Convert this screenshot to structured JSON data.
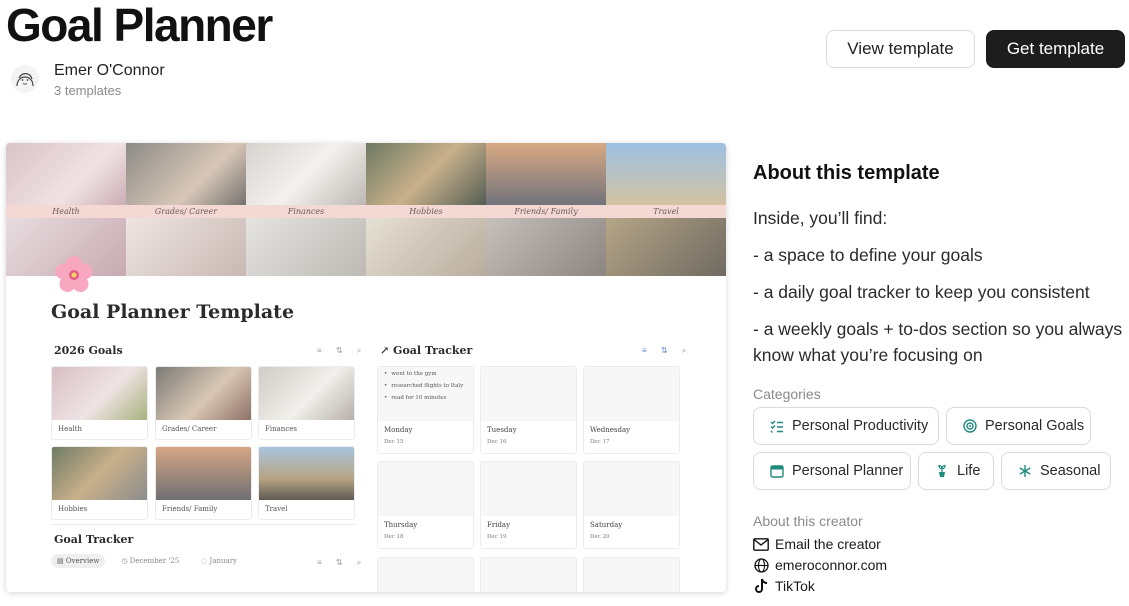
{
  "header": {
    "title": "Goal Planner",
    "creator_name": "Emer O'Connor",
    "creator_templates": "3 templates",
    "view_button": "View template",
    "get_button": "Get template"
  },
  "preview": {
    "banner_labels": [
      "Health",
      "Grades/ Career",
      "Finances",
      "Hobbies",
      "Friends/ Family",
      "Travel"
    ],
    "page_title": "Goal Planner Template",
    "goals_heading": "2026 Goals",
    "goal_cards": [
      "Health",
      "Grades/ Career",
      "Finances",
      "Hobbies",
      "Friends/ Family",
      "Travel"
    ],
    "tracker_heading": "Goal Tracker",
    "tracker_items": [
      "went to the gym",
      "researched flights to Italy",
      "read for 10 minutes"
    ],
    "days": [
      {
        "day": "Monday",
        "date": "Dec 15"
      },
      {
        "day": "Tuesday",
        "date": "Dec 16"
      },
      {
        "day": "Wednesday",
        "date": "Dec 17"
      },
      {
        "day": "Thursday",
        "date": "Dec 18"
      },
      {
        "day": "Friday",
        "date": "Dec 19"
      },
      {
        "day": "Saturday",
        "date": "Dec 20"
      }
    ],
    "bottom_heading": "Goal Tracker",
    "tabs": [
      "Overview",
      "December '25",
      "January"
    ]
  },
  "about": {
    "title": "About this template",
    "lines": [
      "Inside, you’ll find:",
      "- a space to define your goals",
      "- a daily goal tracker to keep you consistent",
      "- a weekly goals + to-dos section so you always know what you’re focusing on"
    ],
    "categories_label": "Categories",
    "categories": [
      "Personal Productivity",
      "Personal Goals",
      "Personal Planner",
      "Life",
      "Seasonal"
    ],
    "creator_label": "About this creator",
    "links": [
      "Email the creator",
      "emeroconnor.com",
      "TikTok"
    ]
  },
  "colors": {
    "banner_strip": "#f3d8d4",
    "get_button_bg": "#1d1d1d",
    "accent_blue": "#5b86c9",
    "category_teal": "#1f8a7e"
  }
}
